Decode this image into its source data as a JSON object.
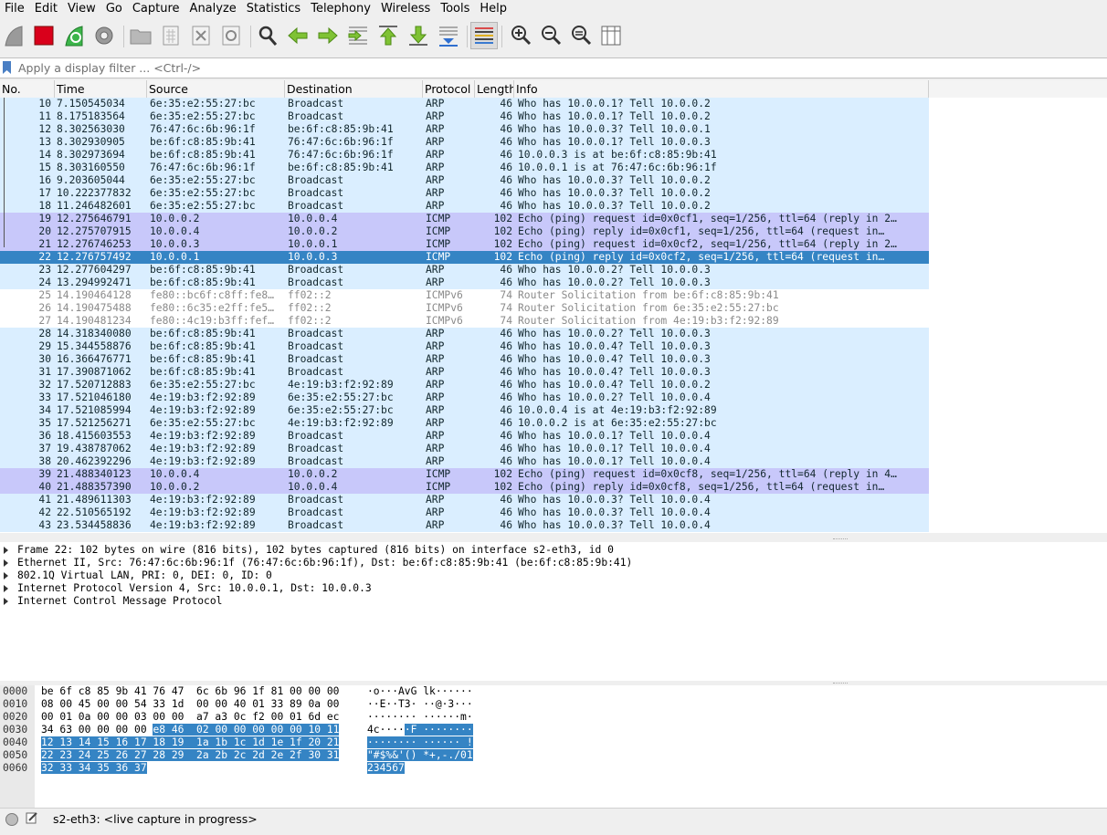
{
  "menu": [
    "File",
    "Edit",
    "View",
    "Go",
    "Capture",
    "Analyze",
    "Statistics",
    "Telephony",
    "Wireless",
    "Tools",
    "Help"
  ],
  "toolbar": {
    "buttons": [
      "shark-fin-start",
      "stop-square",
      "restart-capture",
      "capture-options",
      "open-file",
      "save-file",
      "close-file",
      "reload-file",
      "find-packet",
      "go-back",
      "go-forward",
      "go-to-packet",
      "go-first",
      "go-last",
      "autoscroll",
      "colorize",
      "zoom-in",
      "zoom-out",
      "zoom-normal",
      "resize-columns"
    ]
  },
  "filter": {
    "placeholder": "Apply a display filter ... <Ctrl-/>",
    "value": ""
  },
  "packet_list": {
    "columns": [
      "No.",
      "Time",
      "Source",
      "Destination",
      "Protocol",
      "Length",
      "Info"
    ],
    "rows": [
      {
        "no": "10",
        "time": "7.150545034",
        "src": "6e:35:e2:55:27:bc",
        "dst": "Broadcast",
        "proto": "ARP",
        "len": "46",
        "info": "Who has 10.0.0.1? Tell 10.0.0.2",
        "kind": "arp"
      },
      {
        "no": "11",
        "time": "8.175183564",
        "src": "6e:35:e2:55:27:bc",
        "dst": "Broadcast",
        "proto": "ARP",
        "len": "46",
        "info": "Who has 10.0.0.1? Tell 10.0.0.2",
        "kind": "arp"
      },
      {
        "no": "12",
        "time": "8.302563030",
        "src": "76:47:6c:6b:96:1f",
        "dst": "be:6f:c8:85:9b:41",
        "proto": "ARP",
        "len": "46",
        "info": "Who has 10.0.0.3? Tell 10.0.0.1",
        "kind": "arp"
      },
      {
        "no": "13",
        "time": "8.302930905",
        "src": "be:6f:c8:85:9b:41",
        "dst": "76:47:6c:6b:96:1f",
        "proto": "ARP",
        "len": "46",
        "info": "Who has 10.0.0.1? Tell 10.0.0.3",
        "kind": "arp"
      },
      {
        "no": "14",
        "time": "8.302973694",
        "src": "be:6f:c8:85:9b:41",
        "dst": "76:47:6c:6b:96:1f",
        "proto": "ARP",
        "len": "46",
        "info": "10.0.0.3 is at be:6f:c8:85:9b:41",
        "kind": "arp"
      },
      {
        "no": "15",
        "time": "8.303160550",
        "src": "76:47:6c:6b:96:1f",
        "dst": "be:6f:c8:85:9b:41",
        "proto": "ARP",
        "len": "46",
        "info": "10.0.0.1 is at 76:47:6c:6b:96:1f",
        "kind": "arp"
      },
      {
        "no": "16",
        "time": "9.203605044",
        "src": "6e:35:e2:55:27:bc",
        "dst": "Broadcast",
        "proto": "ARP",
        "len": "46",
        "info": "Who has 10.0.0.3? Tell 10.0.0.2",
        "kind": "arp"
      },
      {
        "no": "17",
        "time": "10.222377832",
        "src": "6e:35:e2:55:27:bc",
        "dst": "Broadcast",
        "proto": "ARP",
        "len": "46",
        "info": "Who has 10.0.0.3? Tell 10.0.0.2",
        "kind": "arp"
      },
      {
        "no": "18",
        "time": "11.246482601",
        "src": "6e:35:e2:55:27:bc",
        "dst": "Broadcast",
        "proto": "ARP",
        "len": "46",
        "info": "Who has 10.0.0.3? Tell 10.0.0.2",
        "kind": "arp"
      },
      {
        "no": "19",
        "time": "12.275646791",
        "src": "10.0.0.2",
        "dst": "10.0.0.4",
        "proto": "ICMP",
        "len": "102",
        "info": "Echo (ping) request  id=0x0cf1, seq=1/256, ttl=64 (reply in 2…",
        "kind": "icmp"
      },
      {
        "no": "20",
        "time": "12.275707915",
        "src": "10.0.0.4",
        "dst": "10.0.0.2",
        "proto": "ICMP",
        "len": "102",
        "info": "Echo (ping) reply    id=0x0cf1, seq=1/256, ttl=64 (request in…",
        "kind": "icmp"
      },
      {
        "no": "21",
        "time": "12.276746253",
        "src": "10.0.0.3",
        "dst": "10.0.0.1",
        "proto": "ICMP",
        "len": "102",
        "info": "Echo (ping) request  id=0x0cf2, seq=1/256, ttl=64 (reply in 2…",
        "kind": "icmp"
      },
      {
        "no": "22",
        "time": "12.276757492",
        "src": "10.0.0.1",
        "dst": "10.0.0.3",
        "proto": "ICMP",
        "len": "102",
        "info": "Echo (ping) reply    id=0x0cf2, seq=1/256, ttl=64 (request in…",
        "kind": "selected"
      },
      {
        "no": "23",
        "time": "12.277604297",
        "src": "be:6f:c8:85:9b:41",
        "dst": "Broadcast",
        "proto": "ARP",
        "len": "46",
        "info": "Who has 10.0.0.2? Tell 10.0.0.3",
        "kind": "arp"
      },
      {
        "no": "24",
        "time": "13.294992471",
        "src": "be:6f:c8:85:9b:41",
        "dst": "Broadcast",
        "proto": "ARP",
        "len": "46",
        "info": "Who has 10.0.0.2? Tell 10.0.0.3",
        "kind": "arp"
      },
      {
        "no": "25",
        "time": "14.190464128",
        "src": "fe80::bc6f:c8ff:fe8…",
        "dst": "ff02::2",
        "proto": "ICMPv6",
        "len": "74",
        "info": "Router Solicitation from be:6f:c8:85:9b:41",
        "kind": "icmpv6"
      },
      {
        "no": "26",
        "time": "14.190475488",
        "src": "fe80::6c35:e2ff:fe5…",
        "dst": "ff02::2",
        "proto": "ICMPv6",
        "len": "74",
        "info": "Router Solicitation from 6e:35:e2:55:27:bc",
        "kind": "icmpv6"
      },
      {
        "no": "27",
        "time": "14.190481234",
        "src": "fe80::4c19:b3ff:fef…",
        "dst": "ff02::2",
        "proto": "ICMPv6",
        "len": "74",
        "info": "Router Solicitation from 4e:19:b3:f2:92:89",
        "kind": "icmpv6"
      },
      {
        "no": "28",
        "time": "14.318340080",
        "src": "be:6f:c8:85:9b:41",
        "dst": "Broadcast",
        "proto": "ARP",
        "len": "46",
        "info": "Who has 10.0.0.2? Tell 10.0.0.3",
        "kind": "arp"
      },
      {
        "no": "29",
        "time": "15.344558876",
        "src": "be:6f:c8:85:9b:41",
        "dst": "Broadcast",
        "proto": "ARP",
        "len": "46",
        "info": "Who has 10.0.0.4? Tell 10.0.0.3",
        "kind": "arp"
      },
      {
        "no": "30",
        "time": "16.366476771",
        "src": "be:6f:c8:85:9b:41",
        "dst": "Broadcast",
        "proto": "ARP",
        "len": "46",
        "info": "Who has 10.0.0.4? Tell 10.0.0.3",
        "kind": "arp"
      },
      {
        "no": "31",
        "time": "17.390871062",
        "src": "be:6f:c8:85:9b:41",
        "dst": "Broadcast",
        "proto": "ARP",
        "len": "46",
        "info": "Who has 10.0.0.4? Tell 10.0.0.3",
        "kind": "arp"
      },
      {
        "no": "32",
        "time": "17.520712883",
        "src": "6e:35:e2:55:27:bc",
        "dst": "4e:19:b3:f2:92:89",
        "proto": "ARP",
        "len": "46",
        "info": "Who has 10.0.0.4? Tell 10.0.0.2",
        "kind": "arp"
      },
      {
        "no": "33",
        "time": "17.521046180",
        "src": "4e:19:b3:f2:92:89",
        "dst": "6e:35:e2:55:27:bc",
        "proto": "ARP",
        "len": "46",
        "info": "Who has 10.0.0.2? Tell 10.0.0.4",
        "kind": "arp"
      },
      {
        "no": "34",
        "time": "17.521085994",
        "src": "4e:19:b3:f2:92:89",
        "dst": "6e:35:e2:55:27:bc",
        "proto": "ARP",
        "len": "46",
        "info": "10.0.0.4 is at 4e:19:b3:f2:92:89",
        "kind": "arp"
      },
      {
        "no": "35",
        "time": "17.521256271",
        "src": "6e:35:e2:55:27:bc",
        "dst": "4e:19:b3:f2:92:89",
        "proto": "ARP",
        "len": "46",
        "info": "10.0.0.2 is at 6e:35:e2:55:27:bc",
        "kind": "arp"
      },
      {
        "no": "36",
        "time": "18.415603553",
        "src": "4e:19:b3:f2:92:89",
        "dst": "Broadcast",
        "proto": "ARP",
        "len": "46",
        "info": "Who has 10.0.0.1? Tell 10.0.0.4",
        "kind": "arp"
      },
      {
        "no": "37",
        "time": "19.438787062",
        "src": "4e:19:b3:f2:92:89",
        "dst": "Broadcast",
        "proto": "ARP",
        "len": "46",
        "info": "Who has 10.0.0.1? Tell 10.0.0.4",
        "kind": "arp"
      },
      {
        "no": "38",
        "time": "20.462392296",
        "src": "4e:19:b3:f2:92:89",
        "dst": "Broadcast",
        "proto": "ARP",
        "len": "46",
        "info": "Who has 10.0.0.1? Tell 10.0.0.4",
        "kind": "arp"
      },
      {
        "no": "39",
        "time": "21.488340123",
        "src": "10.0.0.4",
        "dst": "10.0.0.2",
        "proto": "ICMP",
        "len": "102",
        "info": "Echo (ping) request  id=0x0cf8, seq=1/256, ttl=64 (reply in 4…",
        "kind": "icmp"
      },
      {
        "no": "40",
        "time": "21.488357390",
        "src": "10.0.0.2",
        "dst": "10.0.0.4",
        "proto": "ICMP",
        "len": "102",
        "info": "Echo (ping) reply    id=0x0cf8, seq=1/256, ttl=64 (request in…",
        "kind": "icmp"
      },
      {
        "no": "41",
        "time": "21.489611303",
        "src": "4e:19:b3:f2:92:89",
        "dst": "Broadcast",
        "proto": "ARP",
        "len": "46",
        "info": "Who has 10.0.0.3? Tell 10.0.0.4",
        "kind": "arp"
      },
      {
        "no": "42",
        "time": "22.510565192",
        "src": "4e:19:b3:f2:92:89",
        "dst": "Broadcast",
        "proto": "ARP",
        "len": "46",
        "info": "Who has 10.0.0.3? Tell 10.0.0.4",
        "kind": "arp"
      },
      {
        "no": "43",
        "time": "23.534458836",
        "src": "4e:19:b3:f2:92:89",
        "dst": "Broadcast",
        "proto": "ARP",
        "len": "46",
        "info": "Who has 10.0.0.3? Tell 10.0.0.4",
        "kind": "arp"
      }
    ]
  },
  "details": [
    "Frame 22: 102 bytes on wire (816 bits), 102 bytes captured (816 bits) on interface s2-eth3, id 0",
    "Ethernet II, Src: 76:47:6c:6b:96:1f (76:47:6c:6b:96:1f), Dst: be:6f:c8:85:9b:41 (be:6f:c8:85:9b:41)",
    "802.1Q Virtual LAN, PRI: 0, DEI: 0, ID: 0",
    "Internet Protocol Version 4, Src: 10.0.0.1, Dst: 10.0.0.3",
    "Internet Control Message Protocol"
  ],
  "bytes": [
    {
      "offset": "0000",
      "hex_plain": "be 6f c8 85 9b 41 76 47  6c 6b 96 1f 81 00 00 00",
      "hex_hl": "",
      "ascii_plain": "·o···AvG lk······",
      "ascii_hl": ""
    },
    {
      "offset": "0010",
      "hex_plain": "08 00 45 00 00 54 33 1d  00 00 40 01 33 89 0a 00",
      "hex_hl": "",
      "ascii_plain": "··E··T3· ··@·3···",
      "ascii_hl": ""
    },
    {
      "offset": "0020",
      "hex_plain": "00 01 0a 00 00 03 00 00  a7 a3 0c f2 00 01 6d ec",
      "hex_hl": "",
      "ascii_plain": "········ ······m·",
      "ascii_hl": ""
    },
    {
      "offset": "0030",
      "hex_plain": "34 63 00 00 00 00 ",
      "hex_hl": "e8 46  02 00 00 00 00 00 10 11",
      "ascii_plain": "4c····",
      "ascii_hl": "·F ········"
    },
    {
      "offset": "0040",
      "hex_plain": "",
      "hex_hl": "12 13 14 15 16 17 18 19  1a 1b 1c 1d 1e 1f 20 21",
      "ascii_plain": "",
      "ascii_hl": "········ ······ !"
    },
    {
      "offset": "0050",
      "hex_plain": "",
      "hex_hl": "22 23 24 25 26 27 28 29  2a 2b 2c 2d 2e 2f 30 31",
      "ascii_plain": "",
      "ascii_hl": "\"#$%&'() *+,-./01"
    },
    {
      "offset": "0060",
      "hex_plain": "",
      "hex_hl": "32 33 34 35 36 37",
      "ascii_plain": "",
      "ascii_hl": "234567"
    }
  ],
  "status": {
    "text": "s2-eth3: <live capture in progress>"
  },
  "colors": {
    "arp": "#daeeff",
    "icmp": "#c8c8fa",
    "selected": "#3584c4",
    "icmpv6_text": "#8a8a8a"
  }
}
